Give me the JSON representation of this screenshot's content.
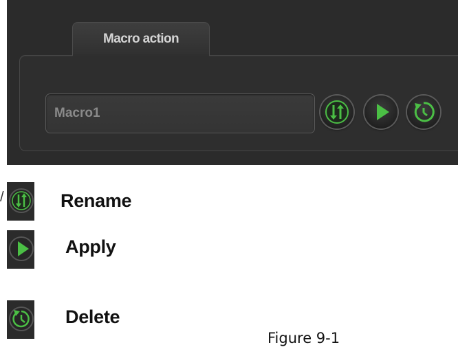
{
  "panel": {
    "tab_label": "Macro action",
    "macro_name_value": "Macro1",
    "buttons": [
      {
        "name": "rename",
        "icon": "swap-arrows-icon"
      },
      {
        "name": "apply",
        "icon": "play-icon"
      },
      {
        "name": "delete",
        "icon": "reset-icon"
      }
    ]
  },
  "legend": {
    "mark": "/",
    "rename_label": "Rename",
    "apply_label": "Apply",
    "delete_label": "Delete"
  },
  "caption": "Figure 9-1",
  "colors": {
    "panel_bg": "#2b2b2b",
    "icon_green": "#4bbf45",
    "tab_text": "#d4d4d4",
    "input_text": "#8a8a8a"
  }
}
